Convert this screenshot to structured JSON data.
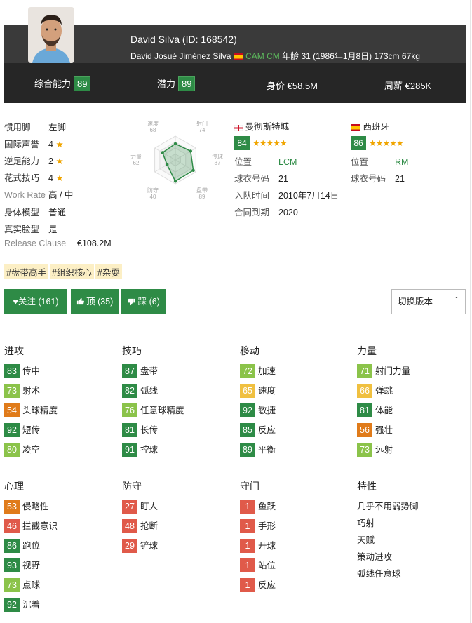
{
  "player": {
    "display_name": "David Silva (ID: 168542)",
    "full_name": "David Josué Jiménez Silva",
    "positions": [
      "CAM",
      "CM"
    ],
    "age_info": "年龄 31 (1986年1月8日) 173cm 67kg",
    "flag_icon": "spain-flag-icon"
  },
  "summary": {
    "overall_label": "综合能力",
    "overall": "89",
    "potential_label": "潜力",
    "potential": "89",
    "value_label": "身价",
    "value": "€58.5M",
    "wage_label": "周薪",
    "wage": "€285K"
  },
  "profile": [
    {
      "label": "惯用脚",
      "value": "左脚"
    },
    {
      "label": "国际声誉",
      "value": "4"
    },
    {
      "label": "逆足能力",
      "value": "2"
    },
    {
      "label": "花式技巧",
      "value": "4"
    },
    {
      "label": "Work Rate",
      "value": "高 / 中"
    },
    {
      "label": "身体模型",
      "value": "普通"
    },
    {
      "label": "真实脸型",
      "value": "是"
    },
    {
      "label": "Release Clause",
      "value": "€108.2M"
    }
  ],
  "radar": {
    "labels": [
      {
        "name": "速度",
        "value": "68"
      },
      {
        "name": "射门",
        "value": "74"
      },
      {
        "name": "传球",
        "value": "87"
      },
      {
        "name": "盘带",
        "value": "89"
      },
      {
        "name": "防守",
        "value": "40"
      },
      {
        "name": "力量",
        "value": "62"
      }
    ]
  },
  "club": {
    "name": "曼彻斯特城",
    "rating": "84",
    "stars": "★★★★★",
    "position_label": "位置",
    "position": "LCM",
    "number_label": "球衣号码",
    "number": "21",
    "joined_label": "入队时间",
    "joined": "2010年7月14日",
    "contract_label": "合同到期",
    "contract": "2020"
  },
  "national": {
    "name": "西班牙",
    "rating": "86",
    "stars": "★★★★★",
    "position_label": "位置",
    "position": "RM",
    "number_label": "球衣号码",
    "number": "21"
  },
  "tags": [
    "#盘带高手",
    "#组织核心",
    "#杂耍"
  ],
  "actions": {
    "follow": "关注 (161)",
    "like": "顶 (35)",
    "dislike": "踩 (6)",
    "version_select": "切换版本"
  },
  "groups_row1": [
    {
      "title": "进攻",
      "items": [
        {
          "v": "83",
          "c": "dg",
          "name": "传中"
        },
        {
          "v": "73",
          "c": "lg",
          "name": "射术"
        },
        {
          "v": "54",
          "c": "o",
          "name": "头球精度"
        },
        {
          "v": "92",
          "c": "dg",
          "name": "短传"
        },
        {
          "v": "80",
          "c": "lg",
          "name": "凌空"
        }
      ]
    },
    {
      "title": "技巧",
      "items": [
        {
          "v": "87",
          "c": "dg",
          "name": "盘带"
        },
        {
          "v": "82",
          "c": "dg",
          "name": "弧线"
        },
        {
          "v": "76",
          "c": "lg",
          "name": "任意球精度"
        },
        {
          "v": "81",
          "c": "dg",
          "name": "长传"
        },
        {
          "v": "91",
          "c": "dg",
          "name": "控球"
        }
      ]
    },
    {
      "title": "移动",
      "items": [
        {
          "v": "72",
          "c": "lg",
          "name": "加速"
        },
        {
          "v": "65",
          "c": "y",
          "name": "速度"
        },
        {
          "v": "92",
          "c": "dg",
          "name": "敏捷"
        },
        {
          "v": "85",
          "c": "dg",
          "name": "反应"
        },
        {
          "v": "89",
          "c": "dg",
          "name": "平衡"
        }
      ]
    },
    {
      "title": "力量",
      "items": [
        {
          "v": "71",
          "c": "lg",
          "name": "射门力量"
        },
        {
          "v": "66",
          "c": "y",
          "name": "弹跳"
        },
        {
          "v": "81",
          "c": "dg",
          "name": "体能"
        },
        {
          "v": "56",
          "c": "o",
          "name": "强壮"
        },
        {
          "v": "73",
          "c": "lg",
          "name": "远射"
        }
      ]
    }
  ],
  "groups_row2": [
    {
      "title": "心理",
      "items": [
        {
          "v": "53",
          "c": "o",
          "name": "侵略性"
        },
        {
          "v": "46",
          "c": "r",
          "name": "拦截意识"
        },
        {
          "v": "86",
          "c": "dg",
          "name": "跑位"
        },
        {
          "v": "93",
          "c": "dg",
          "name": "视野"
        },
        {
          "v": "73",
          "c": "lg",
          "name": "点球"
        },
        {
          "v": "92",
          "c": "dg",
          "name": "沉着"
        }
      ]
    },
    {
      "title": "防守",
      "items": [
        {
          "v": "27",
          "c": "r",
          "name": "盯人"
        },
        {
          "v": "48",
          "c": "r",
          "name": "抢断"
        },
        {
          "v": "29",
          "c": "r",
          "name": "铲球"
        }
      ]
    },
    {
      "title": "守门",
      "items": [
        {
          "v": "1",
          "c": "r",
          "name": "鱼跃"
        },
        {
          "v": "1",
          "c": "r",
          "name": "手形"
        },
        {
          "v": "1",
          "c": "r",
          "name": "开球"
        },
        {
          "v": "1",
          "c": "r",
          "name": "站位"
        },
        {
          "v": "1",
          "c": "r",
          "name": "反应"
        }
      ]
    }
  ],
  "traits": {
    "title": "特性",
    "items": [
      "几乎不用弱势脚",
      "巧射",
      "天赋",
      "策动进攻",
      "弧线任意球"
    ]
  }
}
